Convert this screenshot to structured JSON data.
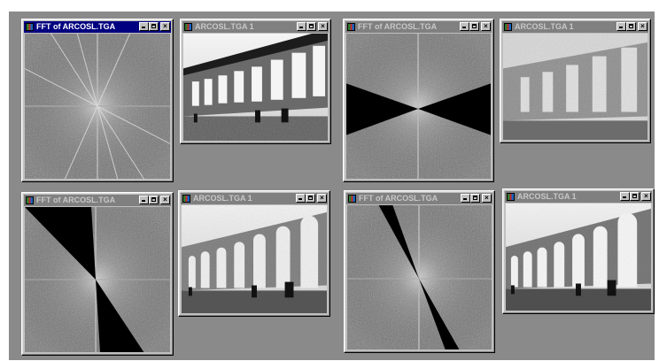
{
  "windows": {
    "fft1": {
      "title": "FFT of ARCOSL.TGA"
    },
    "photo1": {
      "title": "ARCOSL.TGA 1"
    },
    "fft2": {
      "title": "FFT of ARCOSL.TGA"
    },
    "photo2": {
      "title": "ARCOSL.TGA 1"
    },
    "fft3": {
      "title": "FFT of ARCOSL.TGA"
    },
    "photo3": {
      "title": "ARCOSL.TGA 1"
    },
    "fft4": {
      "title": "FFT of ARCOSL.TGA"
    },
    "photo4": {
      "title": "ARCOSL.TGA 1"
    }
  },
  "controls": {
    "minimize": "_",
    "maximize": "□",
    "close": "×"
  },
  "icons": {
    "app": "image-app-icon",
    "minimize": "minimize-icon",
    "maximize": "maximize-icon",
    "close": "close-icon"
  },
  "colors": {
    "desktop": "#8a8a8a",
    "active_title": "#000080",
    "inactive_title": "#808080"
  }
}
